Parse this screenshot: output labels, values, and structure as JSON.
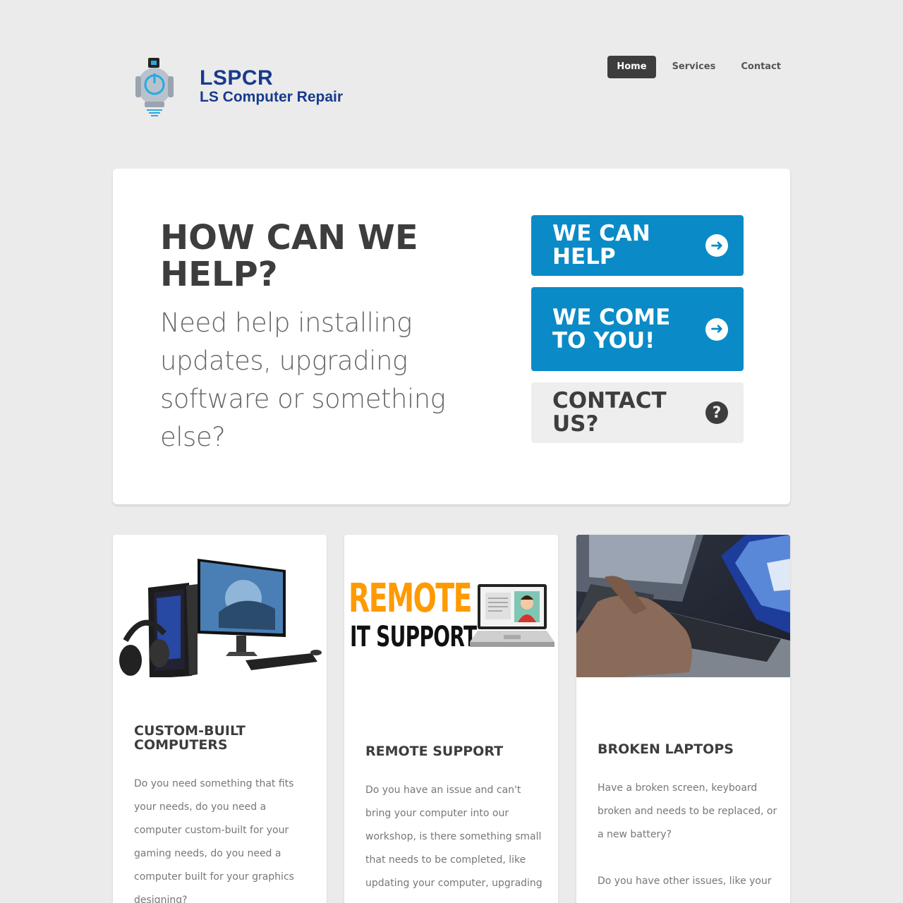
{
  "brand": {
    "title": "LSPCR",
    "subtitle": "LS Computer Repair"
  },
  "nav": {
    "items": [
      {
        "label": "Home",
        "active": true
      },
      {
        "label": "Services",
        "active": false
      },
      {
        "label": "Contact",
        "active": false
      }
    ]
  },
  "hero": {
    "title": "HOW CAN WE HELP?",
    "subtitle": "Need help installing updates, upgrading software or something else?",
    "buttons": [
      {
        "label": "WE CAN HELP",
        "icon": "arrow-right-icon"
      },
      {
        "label": "WE COME TO YOU!",
        "icon": "arrow-right-icon"
      },
      {
        "label": "CONTACT US?",
        "icon": "question-icon"
      }
    ]
  },
  "cards": [
    {
      "title": "CUSTOM-BUILT COMPUTERS",
      "body": "Do you need something that fits your needs, do you need a computer custom-built for your gaming needs, do you need a computer built for your graphics designing?"
    },
    {
      "title": "REMOTE SUPPORT",
      "image_text_1": "REMOTE",
      "image_text_2": "IT SUPPORT",
      "body": "Do you have an issue and can't bring your computer into our workshop, is there something small that needs to be completed, like updating your computer, upgrading"
    },
    {
      "title": "BROKEN LAPTOPS",
      "body": "Have a broken screen, keyboard broken and needs to be replaced, or a new battery?",
      "body2": "Do you have other issues, like your"
    }
  ],
  "colors": {
    "accent": "#0a8bc7",
    "dark": "#3d3d3d",
    "brand": "#183a8e",
    "remote_orange": "#ff9a00"
  }
}
